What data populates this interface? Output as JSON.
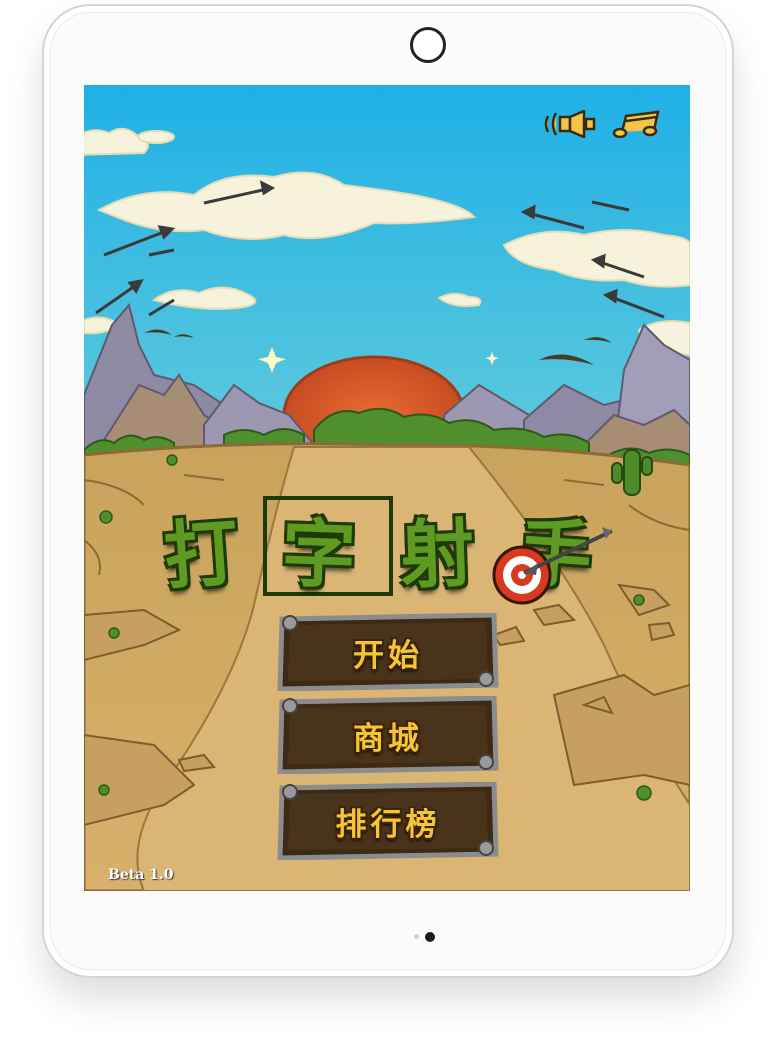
{
  "game": {
    "title_chars": [
      "打",
      "字",
      "射",
      "手"
    ],
    "menu": {
      "start_label": "开始",
      "shop_label": "商城",
      "leaderboard_label": "排行榜"
    },
    "version": "Beta 1.0",
    "icons": {
      "sound": "speaker-icon",
      "music": "music-note-icon",
      "target": "target-icon"
    }
  },
  "colors": {
    "sky": "#2bb6e3",
    "button_text": "#f6c533",
    "title_green": "#5f9a22",
    "ground": "#d3aa63"
  }
}
